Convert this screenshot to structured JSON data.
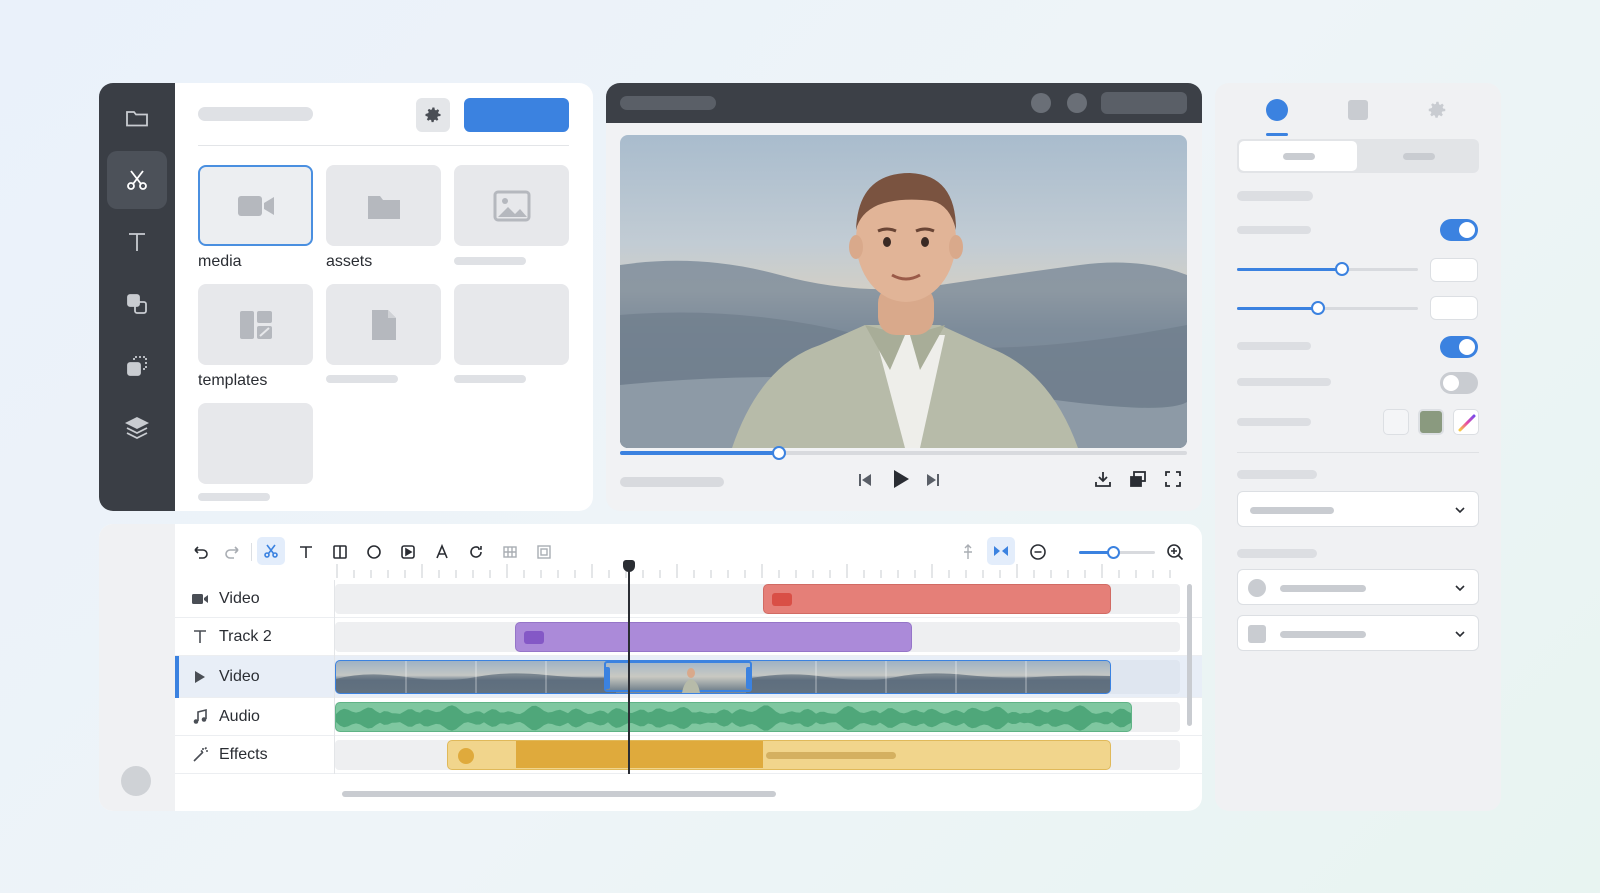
{
  "rail": {
    "icons": [
      "folder-icon",
      "scissors-icon",
      "text-icon",
      "shapes-icon",
      "transitions-icon",
      "layers-icon"
    ],
    "active_index": 1
  },
  "media_panel": {
    "tiles": [
      {
        "label": "media",
        "icon": "video-camera-icon",
        "selected": true
      },
      {
        "label": "assets",
        "icon": "folder-icon"
      },
      {
        "label": "",
        "icon": "image-icon"
      },
      {
        "label": "templates",
        "icon": "template-icon"
      },
      {
        "label": "",
        "icon": "document-icon"
      },
      {
        "label": "",
        "icon": ""
      },
      {
        "label": "",
        "icon": ""
      }
    ]
  },
  "preview": {
    "progress": 0.28
  },
  "timeline": {
    "tracks": [
      {
        "label": "Video",
        "icon": "video-camera-icon"
      },
      {
        "label": "Track 2",
        "icon": "text-icon"
      },
      {
        "label": "Video",
        "icon": "play-icon"
      },
      {
        "label": "Audio",
        "icon": "music-note-icon"
      },
      {
        "label": "Effects",
        "icon": "magic-wand-icon"
      }
    ],
    "zoom_level": 0.45
  },
  "colors": {
    "accent": "#3b82e0",
    "clip_red": "#e57f78",
    "clip_purple": "#ab8ad9",
    "clip_green": "#7fc7a0",
    "clip_yellow": "#f1d58c",
    "clip_yellow_dark": "#dfaa3c"
  },
  "properties": {
    "tabs": [
      "circle-icon",
      "square-icon",
      "gear-icon"
    ],
    "active_tab": 0,
    "toggles": [
      true,
      true,
      false
    ],
    "sliders": [
      0.58,
      0.45
    ]
  }
}
